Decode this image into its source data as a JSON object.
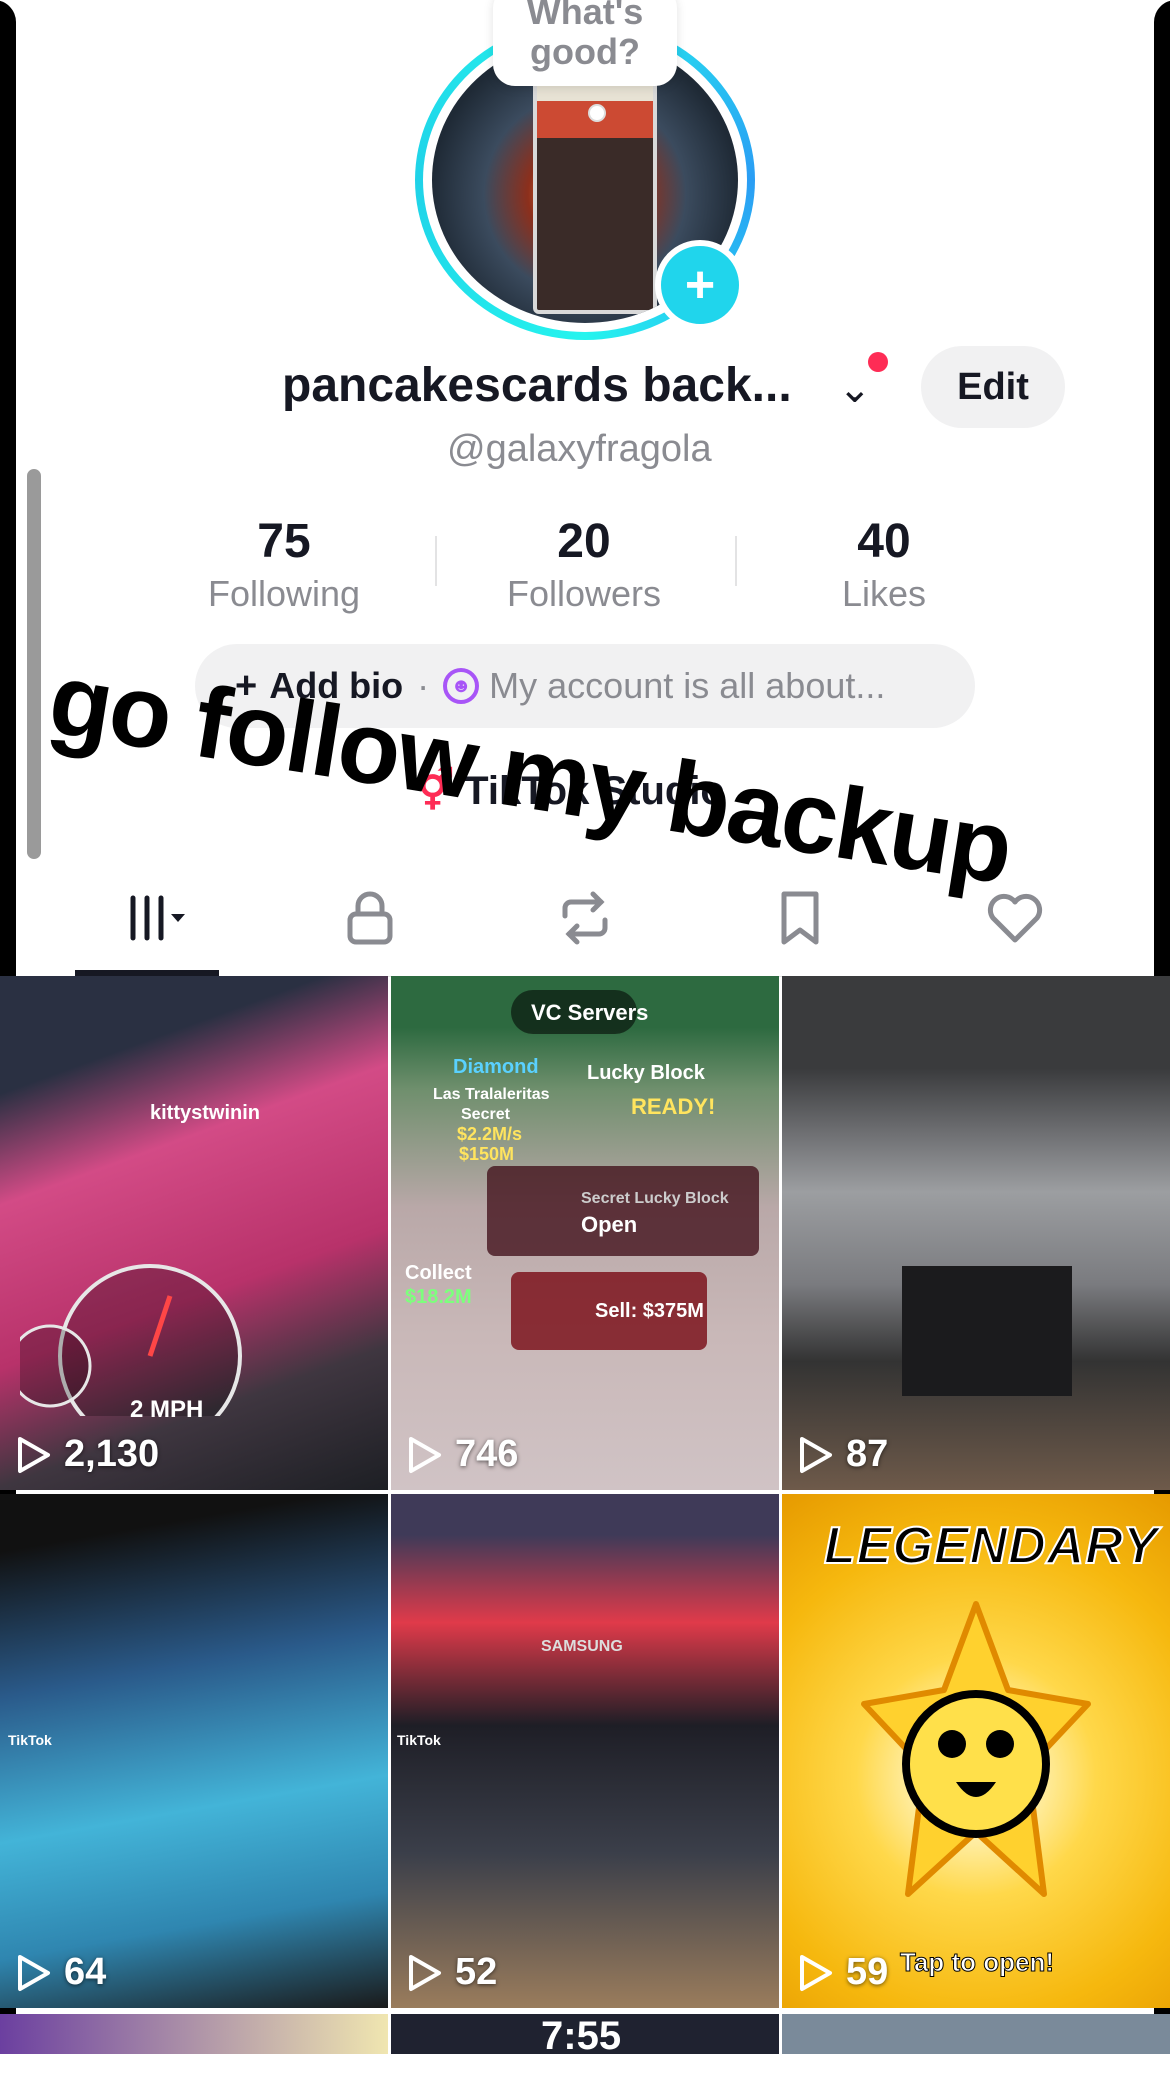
{
  "profile": {
    "bubble_text": "What's good?",
    "name": "pancakescards back...",
    "handle": "@galaxyfragola",
    "edit_label": "Edit"
  },
  "stats": [
    {
      "value": "75",
      "label": "Following"
    },
    {
      "value": "20",
      "label": "Followers"
    },
    {
      "value": "40",
      "label": "Likes"
    }
  ],
  "bio": {
    "add_label": "Add bio",
    "separator": "·",
    "placeholder": "My account is all about..."
  },
  "studio_label": "TikTok Studio",
  "overlay_text": "go follow my backup",
  "tabs": [
    {
      "name": "videos",
      "icon": "grid-icon",
      "active": true
    },
    {
      "name": "private",
      "icon": "lock-icon"
    },
    {
      "name": "reposts",
      "icon": "repost-icon"
    },
    {
      "name": "favorites",
      "icon": "bookmark-icon"
    },
    {
      "name": "liked",
      "icon": "heart-icon"
    }
  ],
  "videos": [
    {
      "views": "2,130"
    },
    {
      "views": "746"
    },
    {
      "views": "87"
    },
    {
      "views": "64"
    },
    {
      "views": "52"
    },
    {
      "views": "59"
    }
  ],
  "tile_text": {
    "t1_caption": "kittystwinin",
    "t1_speed": "2 MPH",
    "t2_servers": "VC Servers",
    "t2_diamond": "Diamond",
    "t2_lucky": "Lucky Block",
    "t2_las": "Las Tralaleritas",
    "t2_secret": "Secret",
    "t2_rate": "$2.2M/s",
    "t2_price": "$150M",
    "t2_ready": "READY!",
    "t2_open_sub": "Secret Lucky Block",
    "t2_open": "Open",
    "t2_collect": "Collect",
    "t2_collect_amt": "$18.2M",
    "t2_sell": "Sell: $375M",
    "t4_watermark": "TikTok",
    "t5_brand": "SAMSUNG",
    "t5_watermark": "TikTok",
    "t6_title": "LEGENDARY",
    "t6_tap": "Tap to open!",
    "peek_time": "7:55"
  },
  "colors": {
    "accent": "#fe2c55",
    "avatar_ring": "#25f4ee",
    "add_button": "#20d5ec",
    "secondary_text": "#8a8b91",
    "pill_bg": "#f1f1f2"
  }
}
